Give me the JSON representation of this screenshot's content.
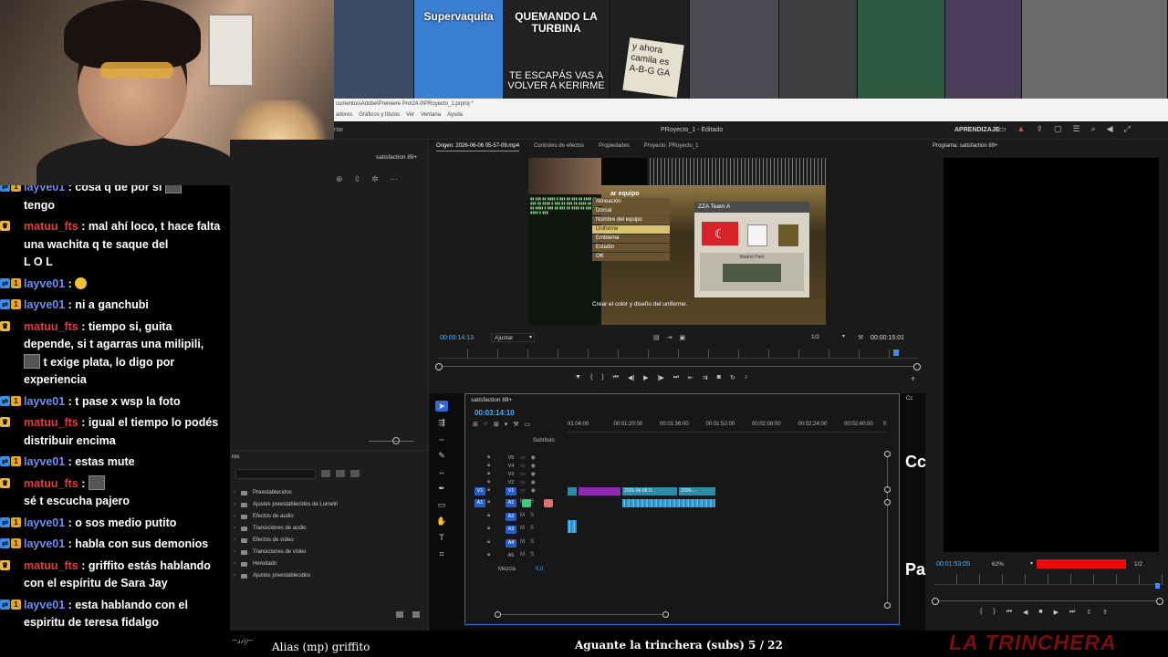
{
  "thumbnails": [
    {
      "title": "",
      "subtitle": "",
      "bg": "#3a4b63"
    },
    {
      "title": "Supervaquita",
      "subtitle": "",
      "bg": "#3b7fd1"
    },
    {
      "title": "QUEMANDO LA TURBINA",
      "subtitle": "TE ESCAPÁS VAS A VOLVER A KERIRME",
      "bg": "#222222"
    },
    {
      "title": "",
      "subtitle": "",
      "note": "y ahora camila es A-B-G GA",
      "bg": "#1e1e1e"
    },
    {
      "title": "",
      "subtitle": "",
      "bg": "#4a4a52"
    },
    {
      "title": "",
      "subtitle": "",
      "bg": "#3d3d40"
    },
    {
      "title": "",
      "subtitle": "",
      "bg": "#2f5a42"
    },
    {
      "title": "",
      "subtitle": "",
      "bg": "#4a3d5a"
    },
    {
      "title": "",
      "subtitle": "",
      "bg": "#6a6a6a"
    }
  ],
  "os_strip": {
    "path": "cumentos\\Adobe\\Premiere Pro\\24.0\\PRoyecto_1.prproj *",
    "menus": [
      "adores",
      "Gráficos y títulos",
      "Ver",
      "Ventana",
      "Ayuda"
    ]
  },
  "premiere_header": {
    "back": "rtar",
    "project_title": "PRoyecto_1 - Editado",
    "learn": "APRENDIZAJE"
  },
  "chat": [
    {
      "user": "layve01",
      "color": "blue",
      "badges": [
        "b-blue",
        "b-gold"
      ],
      "text": ": cosa q de por si",
      "emote_after": true,
      "cont": "tengo"
    },
    {
      "user": "matuu_fts",
      "color": "red",
      "badges": [
        "b-crown"
      ],
      "text": ": mal ahí loco, t hace falta una wachita q te saque del",
      "cont": "L O L"
    },
    {
      "user": "layve01",
      "color": "blue",
      "badges": [
        "b-blue",
        "b-gold"
      ],
      "text": ":",
      "emoji": true
    },
    {
      "user": "layve01",
      "color": "blue",
      "badges": [
        "b-blue",
        "b-gold"
      ],
      "text": ": ni a ganchubi"
    },
    {
      "user": "matuu_fts",
      "color": "red",
      "badges": [
        "b-crown"
      ],
      "text": ": tiempo si, guita depende, si t agarras una milipili,",
      "emote_mid": true,
      "cont": "t exige plata, lo digo por experiencia"
    },
    {
      "user": "layve01",
      "color": "blue",
      "badges": [
        "b-blue",
        "b-gold"
      ],
      "text": ": t pase x wsp la foto"
    },
    {
      "user": "matuu_fts",
      "color": "red",
      "badges": [
        "b-crown"
      ],
      "text": ": igual el tiempo lo podés distribuir encima"
    },
    {
      "user": "layve01",
      "color": "blue",
      "badges": [
        "b-blue",
        "b-gold"
      ],
      "text": ": estas mute"
    },
    {
      "user": "matuu_fts",
      "color": "red",
      "badges": [
        "b-crown"
      ],
      "text": ":",
      "emote_after": true,
      "cont": "sé t escucha pajero"
    },
    {
      "user": "layve01",
      "color": "blue",
      "badges": [
        "b-blue",
        "b-gold"
      ],
      "text": ": o sos medio putito"
    },
    {
      "user": "layve01",
      "color": "blue",
      "badges": [
        "b-blue",
        "b-gold"
      ],
      "text": ": habla con sus demonios"
    },
    {
      "user": "matuu_fts",
      "color": "red",
      "badges": [
        "b-crown"
      ],
      "text": ": griffito estás hablando con el espíritu de Sara Jay"
    },
    {
      "user": "layve01",
      "color": "blue",
      "badges": [
        "b-blue",
        "b-gold"
      ],
      "text": ": esta hablando con el espiritu de teresa fidalgo"
    }
  ],
  "project_panel": {
    "tab_label": "satisfaction 89+",
    "effects_header": "ros",
    "folders": [
      "Preestablecidos",
      "Ajustes preestablecidos de Lumetri",
      "Efectos de audio",
      "Transiciones de audio",
      "Efectos de vídeo",
      "Transiciones de vídeo",
      "Heredado",
      "Ajustes preestablecidos"
    ]
  },
  "source_monitor": {
    "tabs": [
      "Origen: 2026-06-06 05-57-09.mp4",
      "Controles de efectos",
      "Propiedades",
      "Proyecto: PRoyecto_1"
    ],
    "timecode": "00:00:14:13",
    "fit_label": "Ajustar",
    "resolution": "1/2",
    "duration": "00:00:15:01",
    "game_title": "ar equipo",
    "game_menu": [
      "Alineación",
      "Dorsal",
      "Nombre del equipo",
      "Uniforme",
      "Emblema",
      "Estadio",
      "OK"
    ],
    "game_menu_selected": 3,
    "team_name": "ZZA  Team A",
    "kit1_label": "Jug. 1",
    "kit2_label": "Jug. 2",
    "stadium": "Madrid Park",
    "caption": "Crear el color y diseño del uniforme."
  },
  "program_monitor": {
    "tab": "Programa: satisfaction 89+",
    "timecode": "00:01:53:05",
    "zoom": "62%",
    "resolution": "1/2"
  },
  "overlay_captions": [
    "Cc",
    "Pa"
  ],
  "timeline": {
    "tab": "satisfaction 89+",
    "timecode": "00:03:14:10",
    "ruler": [
      "01:04:00",
      "00:01:20:00",
      "00:01:36:00",
      "00:01:52:00",
      "00:02:08:00",
      "00:02:24:00",
      "00:02:40:00",
      "0"
    ],
    "subtitle_label": "Subtítulo",
    "video_tracks": [
      "V5",
      "V4",
      "V3",
      "V2",
      "V1"
    ],
    "audio_tracks": [
      "A1",
      "A2",
      "A3",
      "A4",
      "A5"
    ],
    "clip_label_1": "2026-06-06 0...",
    "clip_label_2": "2026-...",
    "mix_label": "Mezcla",
    "mix_value": "0,0",
    "cc_label": "Cc"
  },
  "bottom_bar": {
    "now_playing": "Alias (mp) griffito",
    "goal": "Aguante la trinchera (subs) 5 / 22",
    "brand": "LA TRINCHERA"
  }
}
